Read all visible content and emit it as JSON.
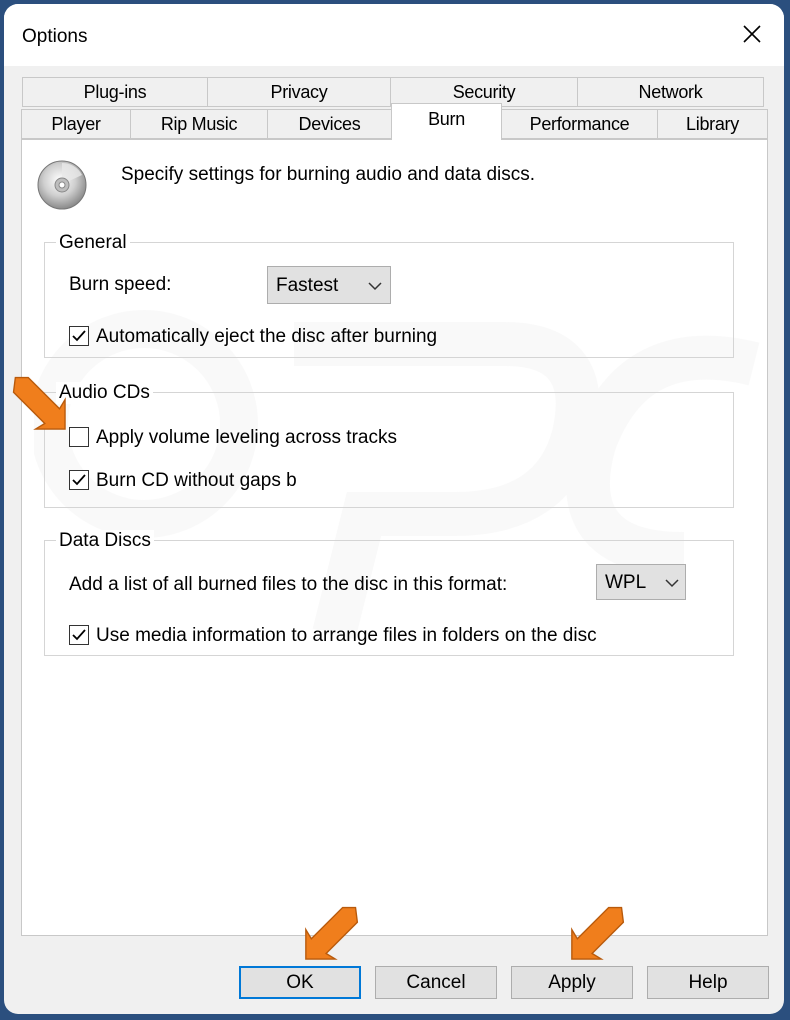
{
  "window": {
    "title": "Options",
    "close_glyph": "close-icon"
  },
  "tabs": {
    "row_top": [
      {
        "label": "Plug-ins"
      },
      {
        "label": "Privacy"
      },
      {
        "label": "Security"
      },
      {
        "label": "Network"
      }
    ],
    "row_bottom": [
      {
        "label": "Player"
      },
      {
        "label": "Rip Music"
      },
      {
        "label": "Devices"
      },
      {
        "label": "Burn",
        "selected": true
      },
      {
        "label": "Performance"
      },
      {
        "label": "Library"
      }
    ]
  },
  "burn": {
    "header": "Specify settings for burning audio and data discs.",
    "general": {
      "legend": "General",
      "burn_speed_label": "Burn speed:",
      "burn_speed_value": "Fastest",
      "auto_eject_label": "Automatically eject the disc after burning",
      "auto_eject_checked": true
    },
    "audio": {
      "legend": "Audio CDs",
      "volume_leveling_label": "Apply volume leveling across tracks",
      "volume_leveling_checked": false,
      "no_gaps_label": "Burn CD without gaps b",
      "no_gaps_checked": true
    },
    "data": {
      "legend": "Data Discs",
      "format_label": "Add a list of all burned files to the disc in this format:",
      "format_value": "WPL",
      "media_info_label": "Use media information to arrange files in folders on the disc",
      "media_info_checked": true
    }
  },
  "buttons": {
    "ok": "OK",
    "cancel": "Cancel",
    "apply": "Apply",
    "help": "Help"
  },
  "colors": {
    "annotation_arrow": "#f07e1c",
    "focus_border": "#0078d7",
    "frame": "#2b4f7e"
  }
}
